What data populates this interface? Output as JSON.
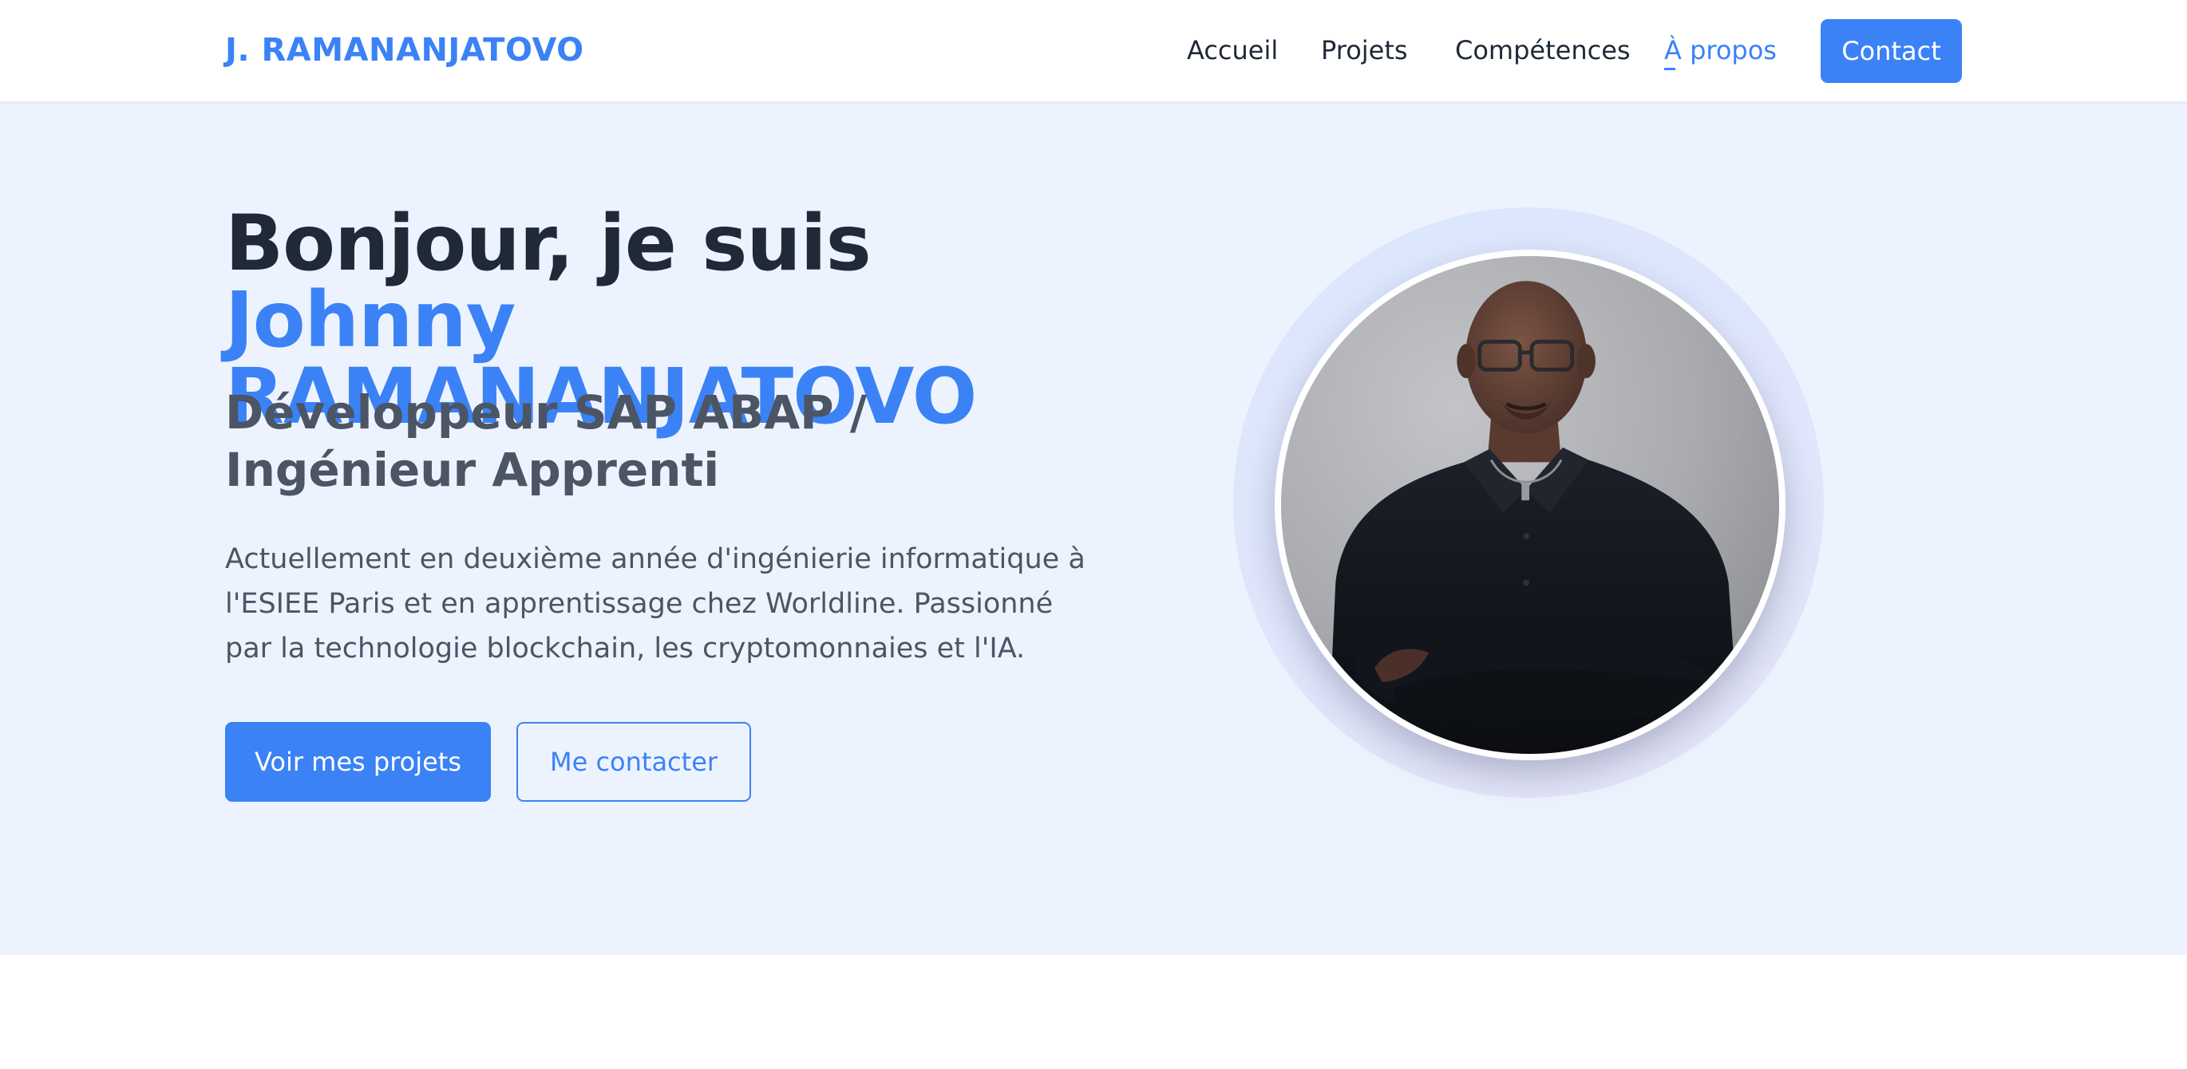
{
  "navbar": {
    "brand": "J. RAMANANJATOVO",
    "links": [
      {
        "label": "Accueil"
      },
      {
        "label": "Projets"
      },
      {
        "label": "Compétences"
      },
      {
        "label": "À propos"
      }
    ],
    "contact_label": "Contact"
  },
  "hero": {
    "title_prefix": "Bonjour, je suis ",
    "title_name": "Johnny RAMANANJATOVO",
    "subtitle": "Développeur SAP ABAP / Ingénieur Apprenti",
    "description": "Actuellement en deuxième année d'ingénierie informatique à l'ESIEE Paris et en apprentissage chez Worldline. Passionné par la technologie blockchain, les cryptomonnaies et l'IA.",
    "primary_button": "Voir mes projets",
    "secondary_button": "Me contacter"
  },
  "colors": {
    "accent": "#3b82f6",
    "hero_background": "#edf3fe",
    "text_dark": "#1f2937",
    "text_muted": "#4b5563"
  }
}
